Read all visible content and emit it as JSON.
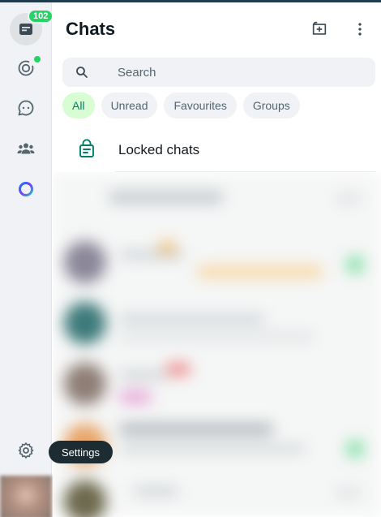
{
  "rail": {
    "chats_badge": "102",
    "settings_tooltip": "Settings"
  },
  "header": {
    "title": "Chats"
  },
  "search": {
    "placeholder": "Search"
  },
  "filters": [
    "All",
    "Unread",
    "Favourites",
    "Groups"
  ],
  "locked": {
    "label": "Locked chats"
  },
  "colors": {
    "accent_green": "#25d366",
    "active_chip_bg": "#d9fdd3",
    "active_chip_text": "#008069",
    "tooltip_bg": "#1d2b33"
  }
}
